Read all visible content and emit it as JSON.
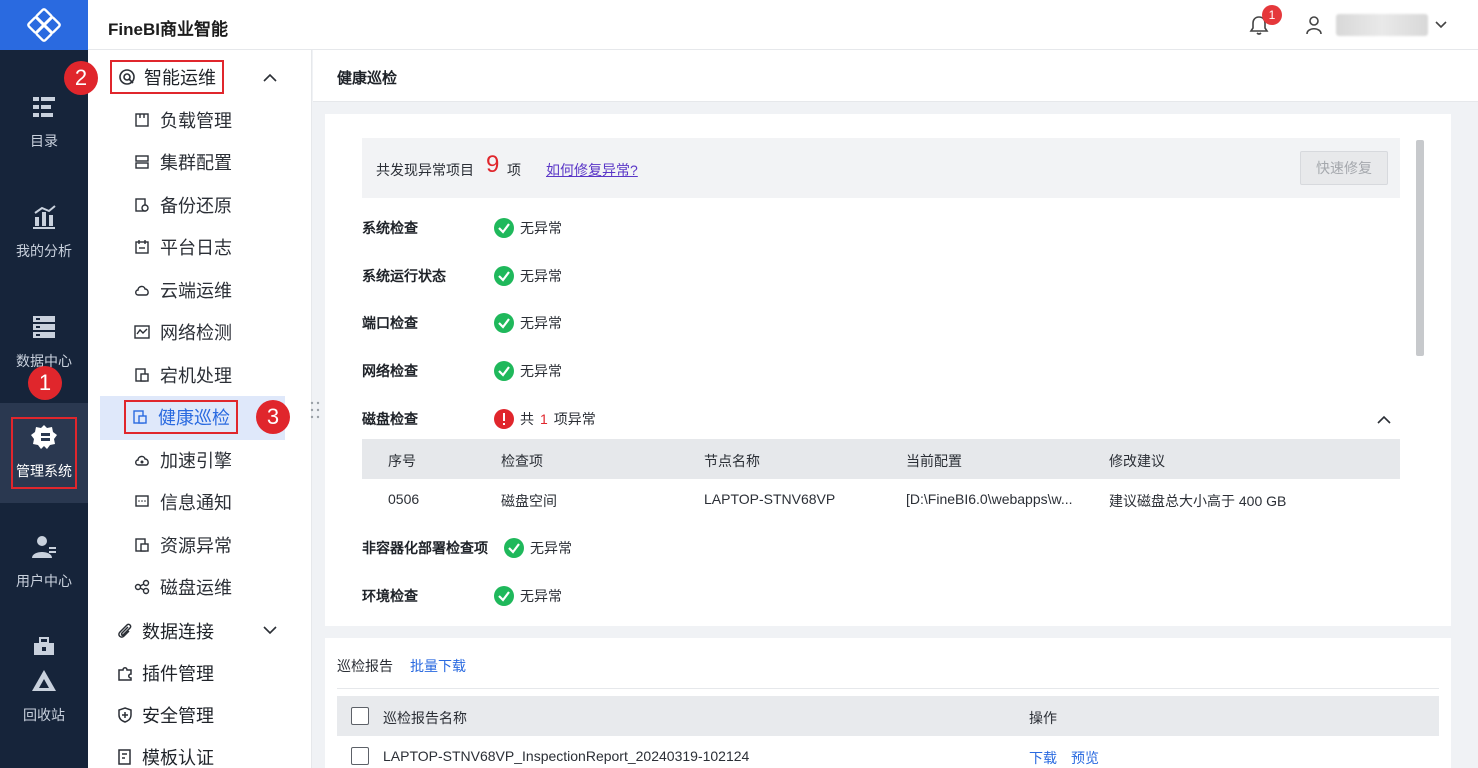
{
  "app": {
    "brand": "FineBI商业智能"
  },
  "header": {
    "notification_count": "1"
  },
  "rail": {
    "items": [
      {
        "label": "目录",
        "icon": "catalog-icon"
      },
      {
        "label": "我的分析",
        "icon": "analysis-icon"
      },
      {
        "label": "数据中心",
        "icon": "data-center-icon"
      },
      {
        "label": "管理系统",
        "icon": "admin-gear-icon"
      },
      {
        "label": "用户中心",
        "icon": "user-center-icon"
      },
      {
        "label": "回收站",
        "icon": "recycle-bin-icon"
      }
    ]
  },
  "steps": {
    "one": "1",
    "two": "2",
    "three": "3"
  },
  "sidebar": {
    "group_ops": "智能运维",
    "items": [
      "负载管理",
      "集群配置",
      "备份还原",
      "平台日志",
      "云端运维",
      "网络检测",
      "宕机处理",
      "健康巡检",
      "加速引擎",
      "信息通知",
      "资源异常",
      "磁盘运维"
    ],
    "group_data": "数据连接",
    "group_plugins": "插件管理",
    "group_security": "安全管理",
    "group_template": "模板认证"
  },
  "main": {
    "title": "健康巡检",
    "summary": {
      "prefix": "共发现异常项目",
      "count": "9",
      "unit": "项",
      "link": "如何修复异常?",
      "quick_fix": "快速修复"
    },
    "checks": [
      {
        "label": "系统检查",
        "status": "无异常"
      },
      {
        "label": "系统运行状态",
        "status": "无异常"
      },
      {
        "label": "端口检查",
        "status": "无异常"
      },
      {
        "label": "网络检查",
        "status": "无异常"
      }
    ],
    "disk": {
      "label": "磁盘检查",
      "status_prefix": "共",
      "status_count": "1",
      "status_suffix": "项异常",
      "columns": [
        "序号",
        "检查项",
        "节点名称",
        "当前配置",
        "修改建议"
      ],
      "row": [
        "0506",
        "磁盘空间",
        "LAPTOP-STNV68VP",
        "[D:\\FineBI6.0\\webapps\\w...",
        "建议磁盘总大小高于 400 GB"
      ]
    },
    "checks_after": [
      {
        "label": "非容器化部署检查项",
        "status": "无异常"
      },
      {
        "label": "环境检查",
        "status": "无异常"
      }
    ]
  },
  "report": {
    "title": "巡检报告",
    "batch_download": "批量下载",
    "col_name": "巡检报告名称",
    "col_action": "操作",
    "row_name": "LAPTOP-STNV68VP_InspectionReport_20240319-102124",
    "download": "下载",
    "preview": "预览"
  },
  "colors": {
    "accent": "#2a6ae0",
    "rail_bg": "#16243a",
    "error": "#e0262c",
    "ok": "#1fb85b"
  }
}
